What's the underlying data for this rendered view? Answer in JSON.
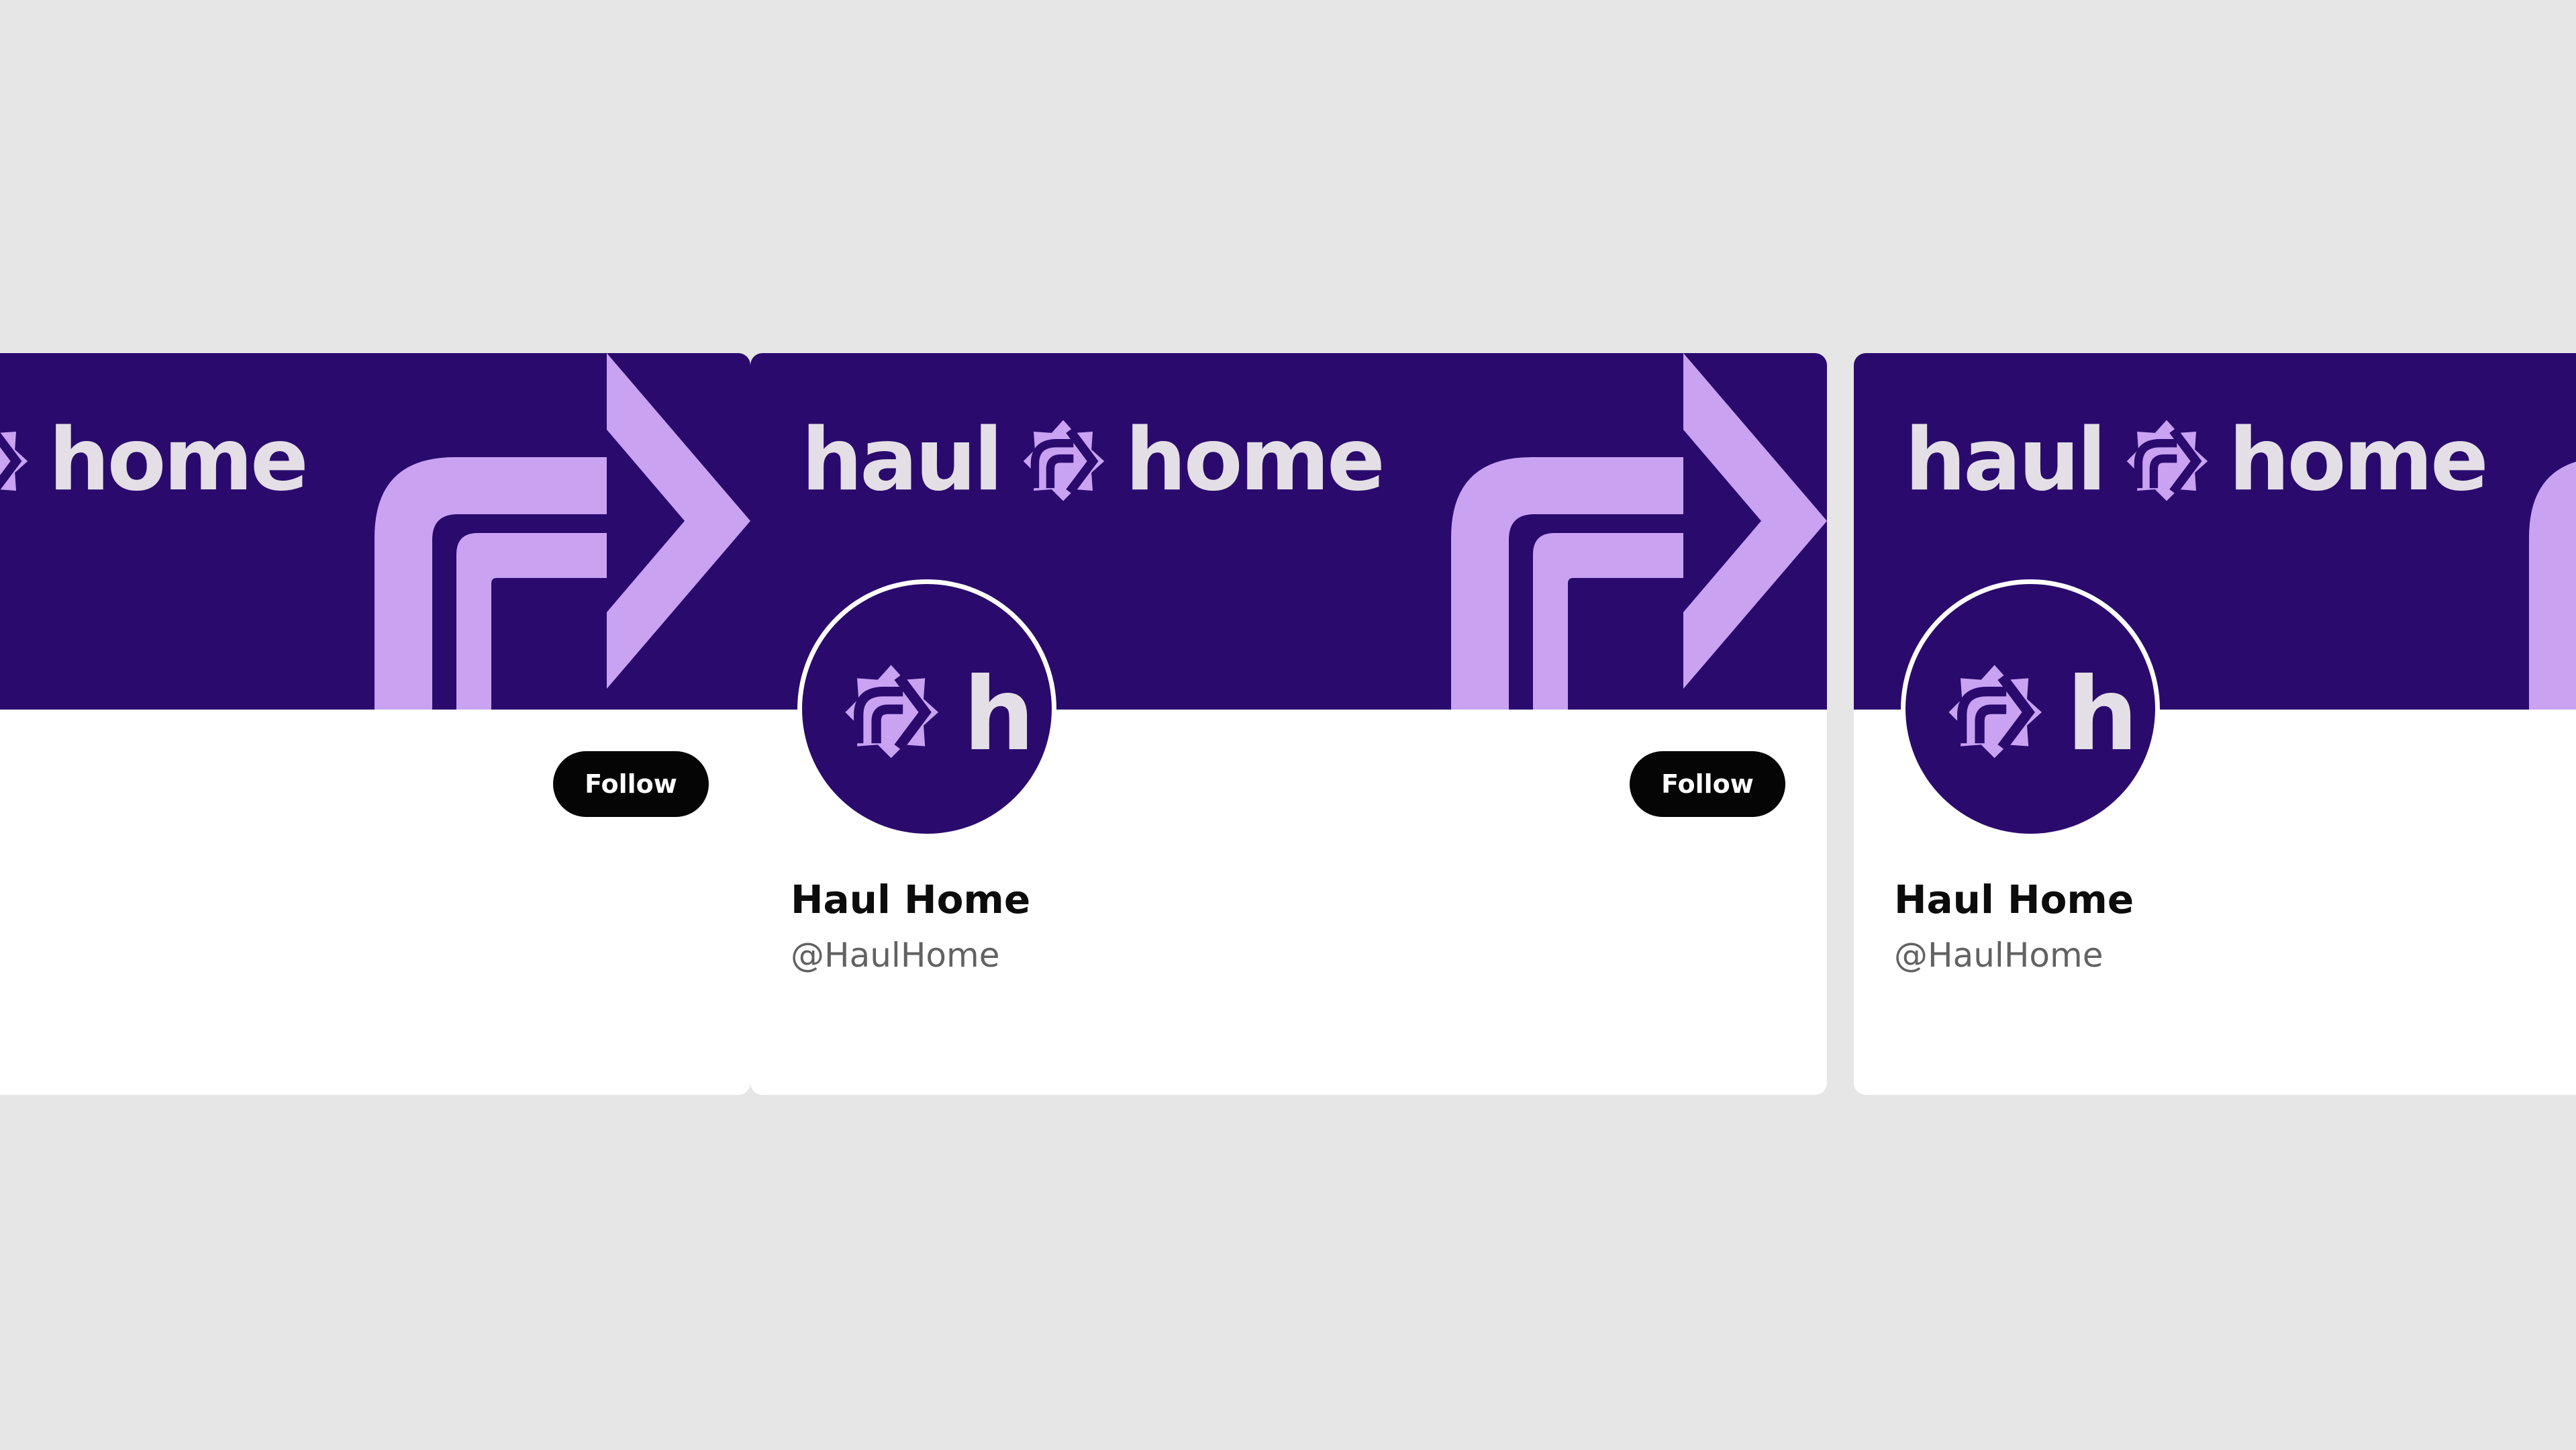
{
  "brand": {
    "word_left": "haul",
    "word_right": "home",
    "avatar_letter": "h",
    "banner_color": "#2a0b6d",
    "accent_color": "#c9a2f2",
    "wordmark_color": "#e4dfe6",
    "logo_icon": "haul-home-arrow-mark-icon"
  },
  "cards": [
    {
      "follow_label": "Follow"
    },
    {
      "display_name": "Haul Home",
      "handle": "@HaulHome",
      "follow_label": "Follow"
    },
    {
      "display_name": "Haul Home",
      "handle": "@HaulHome"
    }
  ]
}
